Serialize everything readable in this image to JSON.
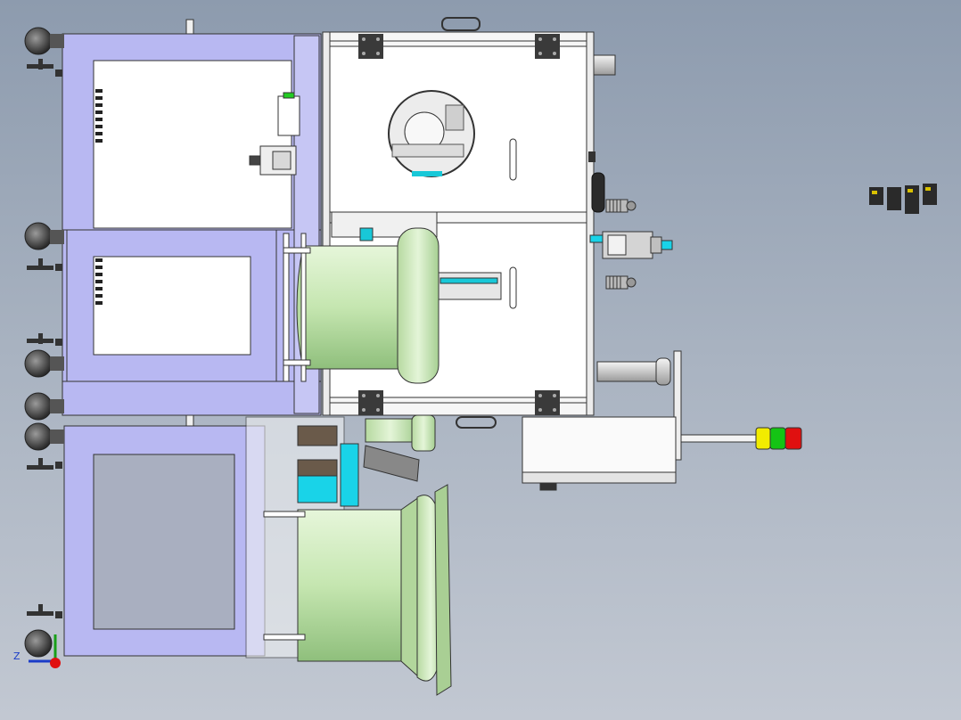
{
  "viewport": {
    "background_top": "#8d9bae",
    "background_bottom": "#c2c8d2"
  },
  "model": {
    "frame_color": "#b8b8f2",
    "panel_color": "#ffffff",
    "feeder_bowl_color": "#c9eab4",
    "edge_color": "#333333",
    "accent_cyan": "#19d3e8",
    "mount_color": "#3a3a3a"
  },
  "signal_tower": {
    "lamps": [
      "yellow",
      "green",
      "red"
    ],
    "colors": [
      "#f2ec00",
      "#14c414",
      "#e01010"
    ]
  },
  "triad": {
    "axis_label": "Z",
    "colors": {
      "z": "#1a3cc8",
      "y": "#18a018",
      "origin": "#e01010"
    }
  }
}
